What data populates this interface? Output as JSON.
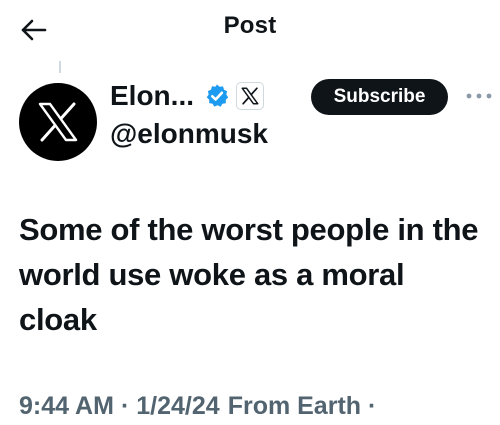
{
  "header": {
    "title": "Post",
    "back_icon": "arrow-left-icon"
  },
  "author": {
    "display_name": "Elon...",
    "handle": "@elonmusk",
    "avatar_icon": "x-logo-icon",
    "verified_icon": "verified-badge-icon",
    "verified_color": "#1d9bf0",
    "affiliate_icon": "x-logo-icon"
  },
  "actions": {
    "subscribe_label": "Subscribe",
    "more_icon": "more-options-icon"
  },
  "post": {
    "text": "Some of the worst people in the world use woke as a moral cloak"
  },
  "meta": {
    "time": "9:44 AM",
    "separator": "·",
    "date": "1/24/24",
    "source": "From Earth",
    "trailing": "·"
  },
  "colors": {
    "text_primary": "#0f1419",
    "text_secondary": "#536471",
    "button_bg": "#0f1419",
    "button_text": "#ffffff",
    "accent": "#1d9bf0",
    "border": "#cfd9de"
  }
}
